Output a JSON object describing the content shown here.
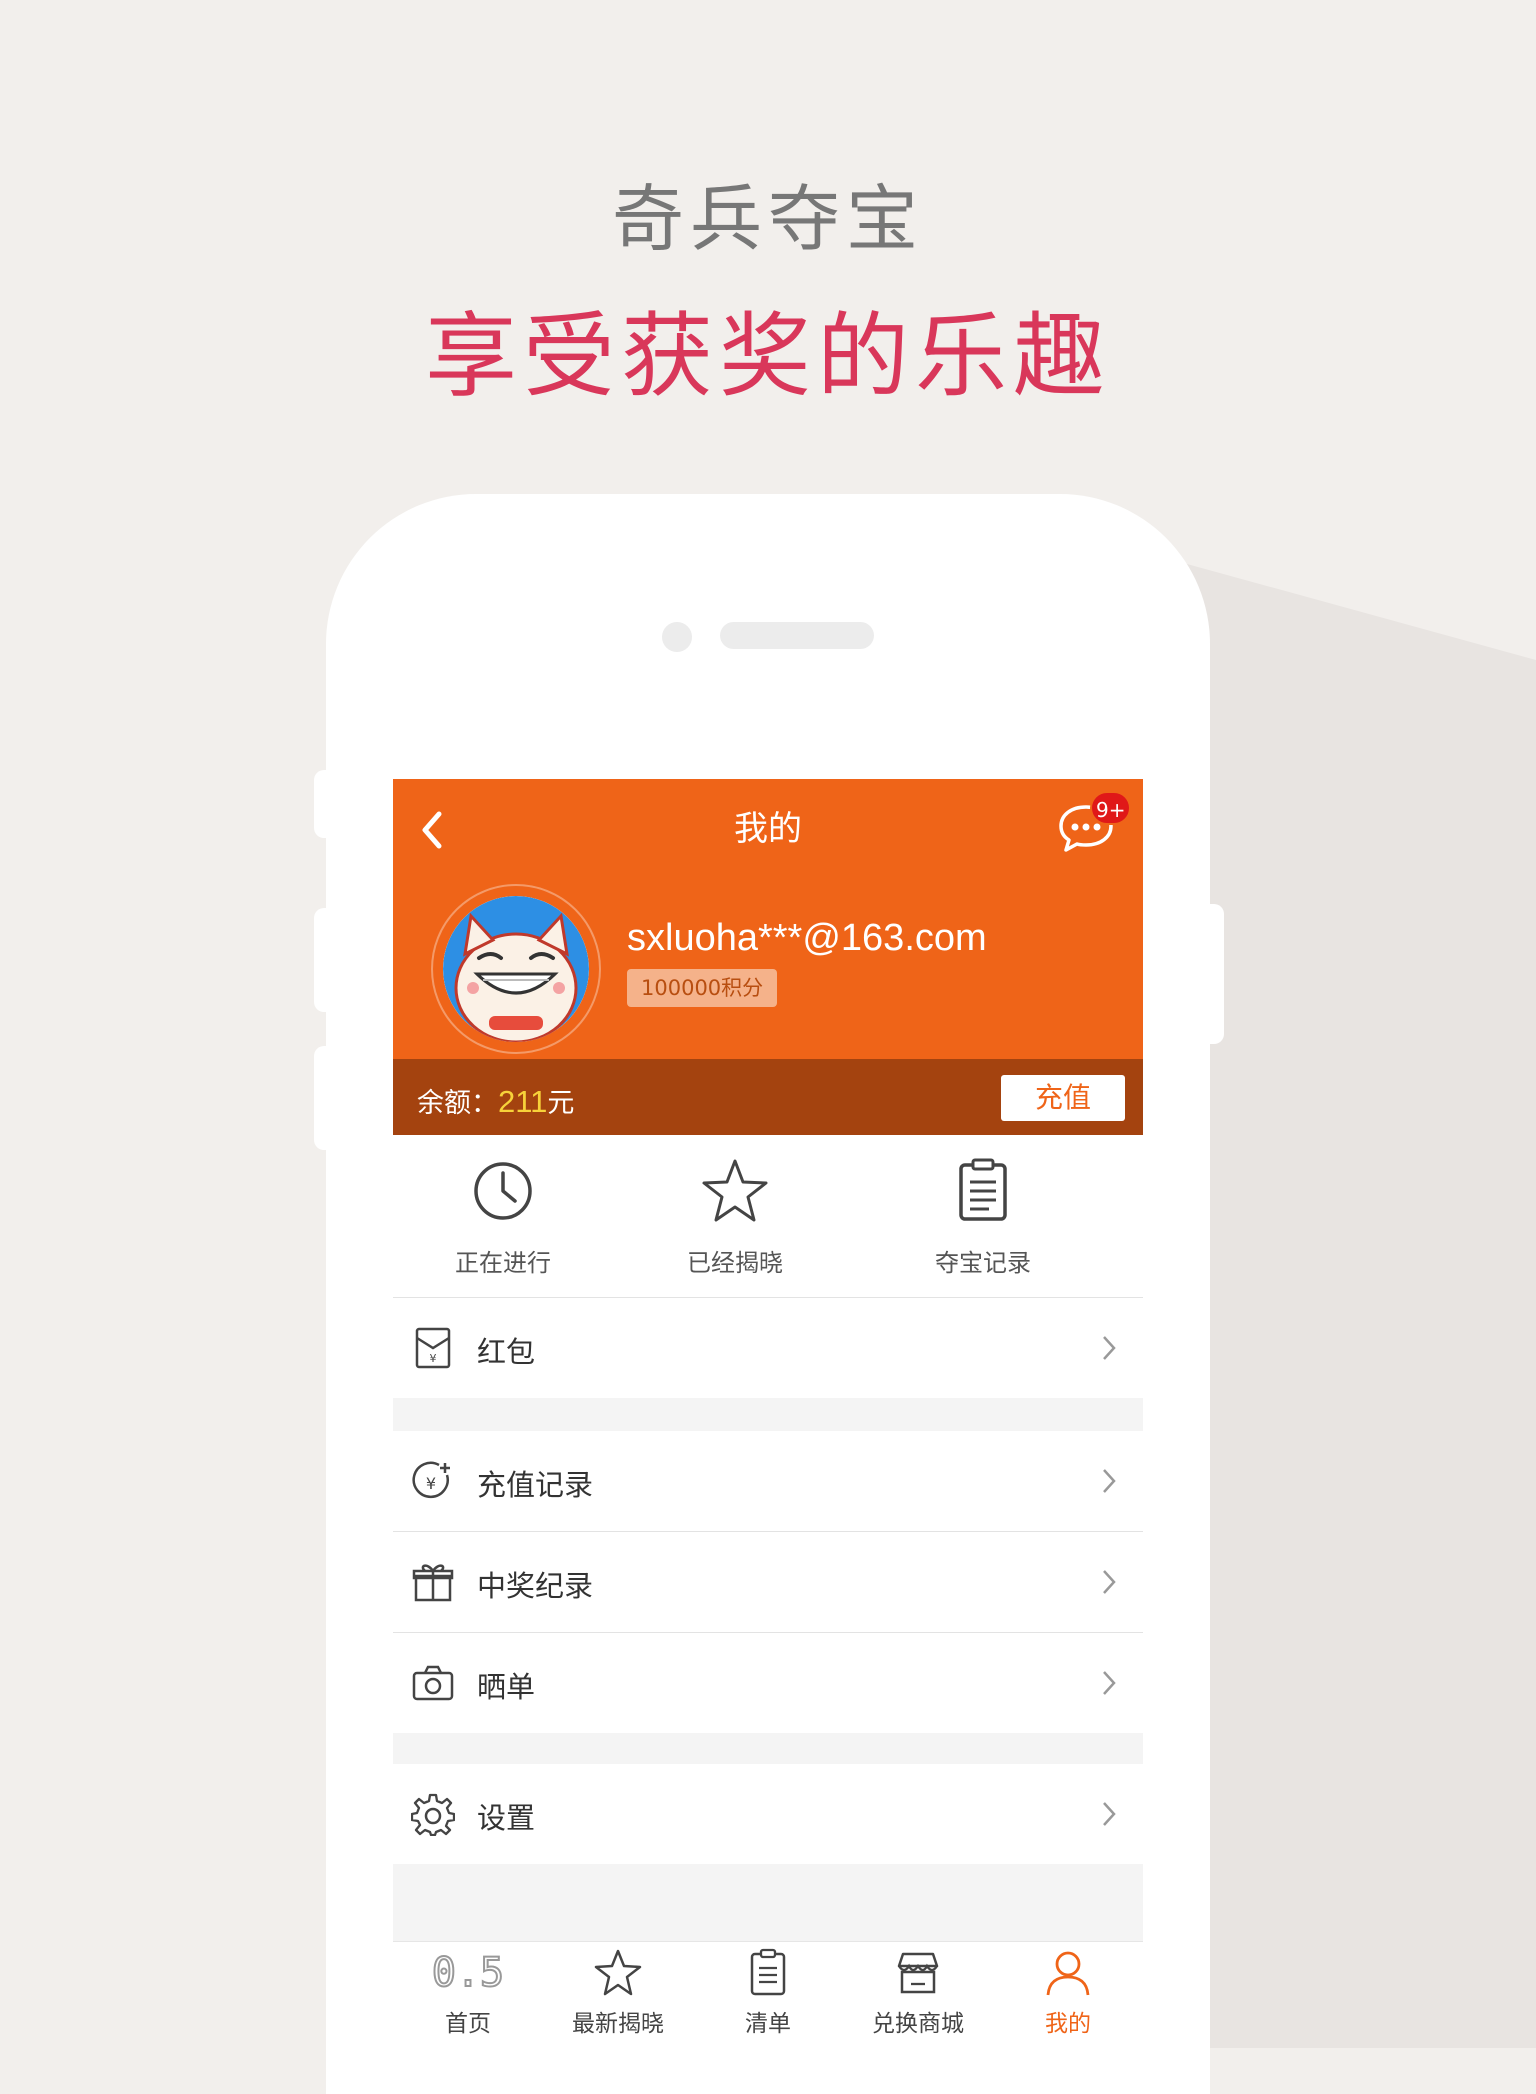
{
  "promo": {
    "headline_1": "奇兵夺宝",
    "headline_2": "享受获奖的乐趣"
  },
  "colors": {
    "accent": "#ef6418",
    "balance_bar": "#a4430f",
    "headline_pink": "#d9375a",
    "badge_red": "#e01818"
  },
  "header": {
    "title": "我的",
    "back_icon": "chevron-left-icon",
    "message_icon": "chat-bubble-icon",
    "message_badge": "9+"
  },
  "profile": {
    "email": "sxluoha***@163.com",
    "points": "100000积分"
  },
  "balance": {
    "label": "余额：",
    "amount": "211",
    "unit": "元",
    "recharge_label": "充值"
  },
  "quick_actions": [
    {
      "label": "正在进行",
      "icon": "clock-icon"
    },
    {
      "label": "已经揭晓",
      "icon": "star-icon"
    },
    {
      "label": "夺宝记录",
      "icon": "clipboard-icon"
    }
  ],
  "menu": {
    "red_packet": "红包",
    "recharge_records": "充值记录",
    "prize_records": "中奖纪录",
    "show_orders": "晒单",
    "settings": "设置"
  },
  "tabbar": {
    "home_icon_text": "0.5",
    "items": [
      {
        "label": "首页"
      },
      {
        "label": "最新揭晓"
      },
      {
        "label": "清单"
      },
      {
        "label": "兑换商城"
      },
      {
        "label": "我的"
      }
    ],
    "active_index": 4
  }
}
